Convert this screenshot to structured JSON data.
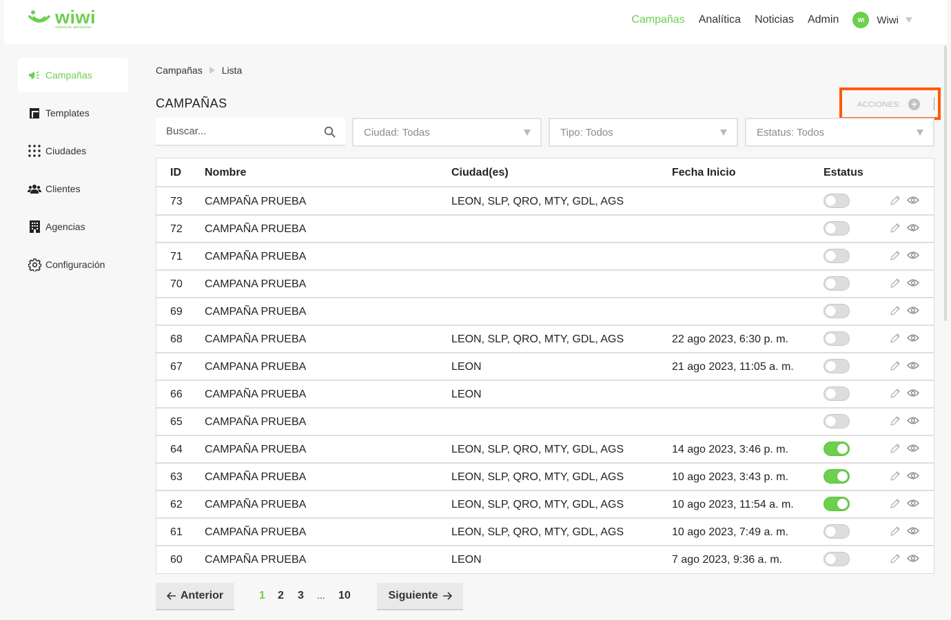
{
  "brand": {
    "name": "wiwi",
    "tagline": "sistema de operaciones",
    "accent": "#6ccf4e"
  },
  "nav": {
    "links": [
      "Campañas",
      "Analítica",
      "Noticias",
      "Admin"
    ],
    "user": {
      "initials": "WI",
      "name": "Wiwi"
    }
  },
  "sidebar": [
    {
      "label": "Campañas",
      "icon": "megaphone-icon",
      "active": true
    },
    {
      "label": "Templates",
      "icon": "template-icon"
    },
    {
      "label": "Ciudades",
      "icon": "grid-dots-icon"
    },
    {
      "label": "Clientes",
      "icon": "users-icon"
    },
    {
      "label": "Agencias",
      "icon": "building-icon"
    },
    {
      "label": "Configuración",
      "icon": "gear-icon"
    }
  ],
  "breadcrumb": [
    "Campañas",
    "Lista"
  ],
  "page_title": "CAMPAÑAS",
  "actions": {
    "label": "ACCIONES:",
    "icon": "plus-circle-icon",
    "highlight_color": "#ff5a00"
  },
  "filters": {
    "search_placeholder": "Buscar...",
    "city": "Ciudad: Todas",
    "type": "Tipo: Todos",
    "status": "Estatus: Todos"
  },
  "table": {
    "headers": [
      "ID",
      "Nombre",
      "Ciudad(es)",
      "Fecha Inicio",
      "Estatus"
    ],
    "rows": [
      {
        "id": "73",
        "name": "CAMPAÑA PRUEBA",
        "cities": "LEON, SLP, QRO, MTY, GDL, AGS",
        "date": "",
        "active": false
      },
      {
        "id": "72",
        "name": "CAMPAÑA PRUEBA",
        "cities": "",
        "date": "",
        "active": false
      },
      {
        "id": "71",
        "name": "CAMPAÑA PRUEBA",
        "cities": "",
        "date": "",
        "active": false
      },
      {
        "id": "70",
        "name": "CAMPANA PRUEBA",
        "cities": "",
        "date": "",
        "active": false
      },
      {
        "id": "69",
        "name": "CAMPAÑA PRUEBA",
        "cities": "",
        "date": "",
        "active": false
      },
      {
        "id": "68",
        "name": "CAMPAÑA PRUEBA",
        "cities": "LEON, SLP, QRO, MTY, GDL, AGS",
        "date": "22 ago 2023, 6:30 p. m.",
        "active": false
      },
      {
        "id": "67",
        "name": "CAMPANA PRUEBA",
        "cities": "LEON",
        "date": "21 ago 2023, 11:05 a. m.",
        "active": false
      },
      {
        "id": "66",
        "name": "CAMPAÑA PRUEBA",
        "cities": "LEON",
        "date": "",
        "active": false
      },
      {
        "id": "65",
        "name": "CAMPAÑA PRUEBA",
        "cities": "",
        "date": "",
        "active": false
      },
      {
        "id": "64",
        "name": "CAMPAÑA PRUEBA",
        "cities": "LEON, SLP, QRO, MTY, GDL, AGS",
        "date": "14 ago 2023, 3:46 p. m.",
        "active": true
      },
      {
        "id": "63",
        "name": "CAMPAÑA PRUEBA",
        "cities": "LEON, SLP, QRO, MTY, GDL, AGS",
        "date": "10 ago 2023, 3:43 p. m.",
        "active": true
      },
      {
        "id": "62",
        "name": "CAMPAÑA PRUEBA",
        "cities": "LEON, SLP, QRO, MTY, GDL, AGS",
        "date": "10 ago 2023, 11:54 a. m.",
        "active": true
      },
      {
        "id": "61",
        "name": "CAMPAÑA PRUEBA",
        "cities": "LEON, SLP, QRO, MTY, GDL, AGS",
        "date": "10 ago 2023, 7:49 a. m.",
        "active": false
      },
      {
        "id": "60",
        "name": "CAMPAÑA PRUEBA",
        "cities": "LEON",
        "date": "7 ago 2023, 9:36 a. m.",
        "active": false
      }
    ]
  },
  "pagination": {
    "prev": "Anterior",
    "next": "Siguiente",
    "pages": [
      "1",
      "2",
      "3",
      "10"
    ],
    "ellipsis": "...",
    "current": "1"
  }
}
